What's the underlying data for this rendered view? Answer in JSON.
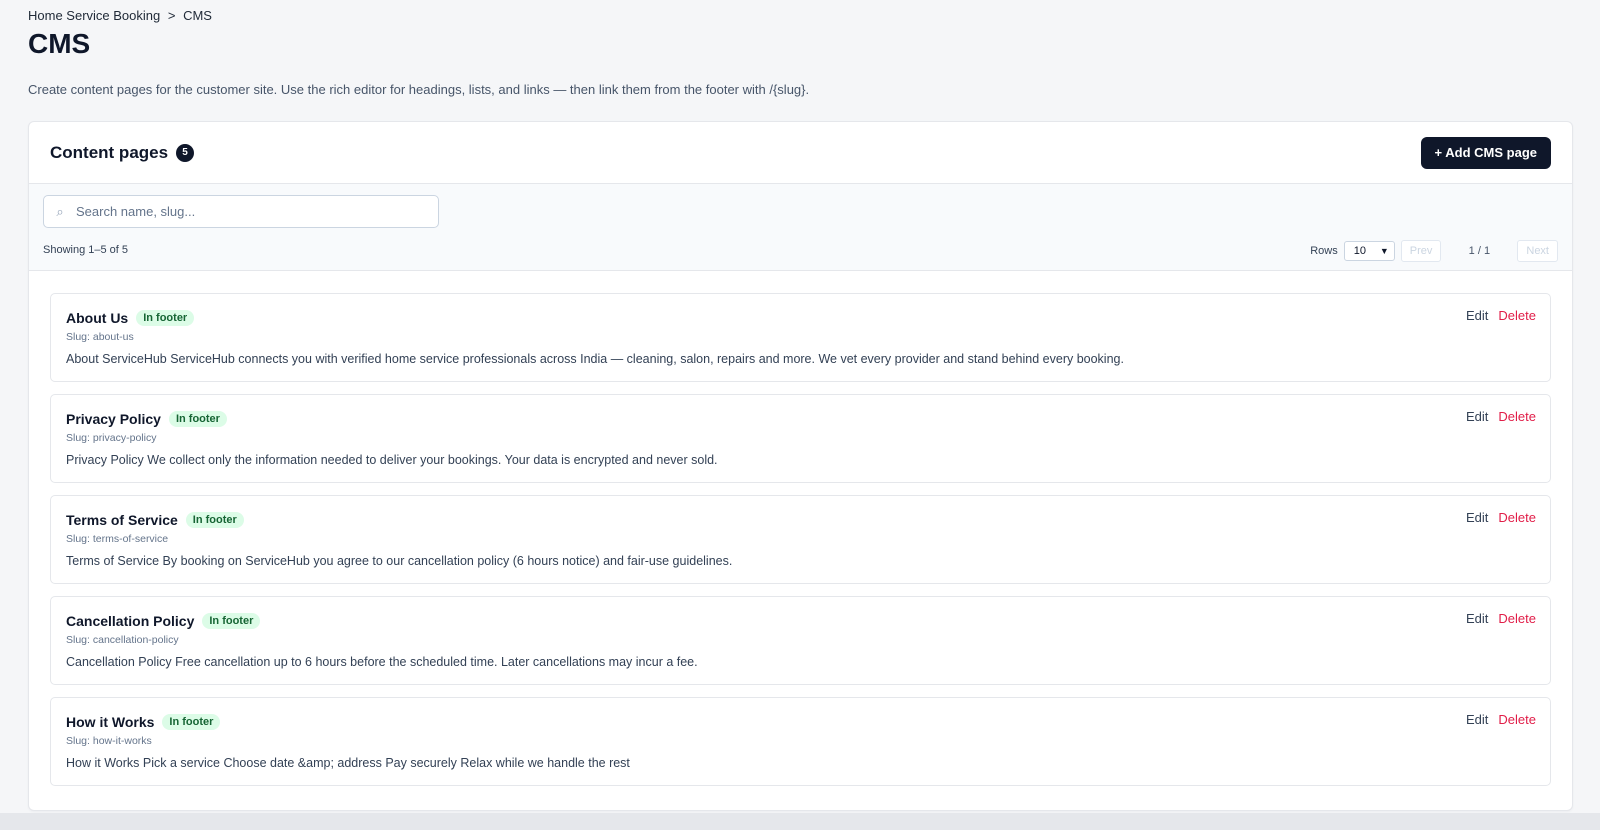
{
  "breadcrumb": {
    "parent": "Home Service Booking",
    "separator": ">",
    "current": "CMS"
  },
  "page": {
    "title": "CMS",
    "description": "Create content pages for the customer site. Use the rich editor for headings, lists, and links — then link them from the footer with /{slug}."
  },
  "card": {
    "title": "Content pages",
    "count": "5",
    "add_button": "+ Add CMS page"
  },
  "search": {
    "icon": "search-icon",
    "placeholder": "Search name, slug..."
  },
  "listing": {
    "showing": "Showing 1–5 of 5",
    "rows_label": "Rows",
    "rows_value": "10",
    "prev": "Prev",
    "page_indicator": "1 / 1",
    "next": "Next"
  },
  "colors": {
    "primary": "#0f172a",
    "badge_bg": "#dcfce7",
    "badge_text": "#166534",
    "danger": "#e11d48"
  },
  "items": [
    {
      "title": "About Us",
      "badge": "In footer",
      "slug": "Slug: about-us",
      "body": "About ServiceHub ServiceHub connects you with verified home service professionals across India — cleaning, salon, repairs and more. We vet every provider and stand behind every booking.",
      "edit": "Edit",
      "delete": "Delete"
    },
    {
      "title": "Privacy Policy",
      "badge": "In footer",
      "slug": "Slug: privacy-policy",
      "body": "Privacy Policy We collect only the information needed to deliver your bookings. Your data is encrypted and never sold.",
      "edit": "Edit",
      "delete": "Delete"
    },
    {
      "title": "Terms of Service",
      "badge": "In footer",
      "slug": "Slug: terms-of-service",
      "body": "Terms of Service By booking on ServiceHub you agree to our cancellation policy (6 hours notice) and fair-use guidelines.",
      "edit": "Edit",
      "delete": "Delete"
    },
    {
      "title": "Cancellation Policy",
      "badge": "In footer",
      "slug": "Slug: cancellation-policy",
      "body": "Cancellation Policy Free cancellation up to 6 hours before the scheduled time. Later cancellations may incur a fee.",
      "edit": "Edit",
      "delete": "Delete"
    },
    {
      "title": "How it Works",
      "badge": "In footer",
      "slug": "Slug: how-it-works",
      "body": "How it Works Pick a service Choose date &amp; address Pay securely Relax while we handle the rest",
      "edit": "Edit",
      "delete": "Delete"
    }
  ]
}
